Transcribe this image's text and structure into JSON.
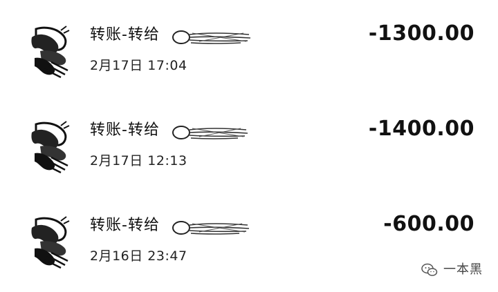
{
  "transactions": [
    {
      "title": "转账-转给",
      "time": "2月17日 17:04",
      "amount": "-1300.00",
      "avatar_icon": "bird-avatar-icon"
    },
    {
      "title": "转账-转给",
      "time": "2月17日 12:13",
      "amount": "-1400.00",
      "avatar_icon": "bird-avatar-icon"
    },
    {
      "title": "转账-转给",
      "time": "2月16日 23:47",
      "amount": "-600.00",
      "avatar_icon": "bird-avatar-icon"
    }
  ],
  "watermark": {
    "text": "一本黑",
    "icon": "wechat-icon"
  },
  "colors": {
    "background": "#ffffff",
    "text": "#111111"
  }
}
